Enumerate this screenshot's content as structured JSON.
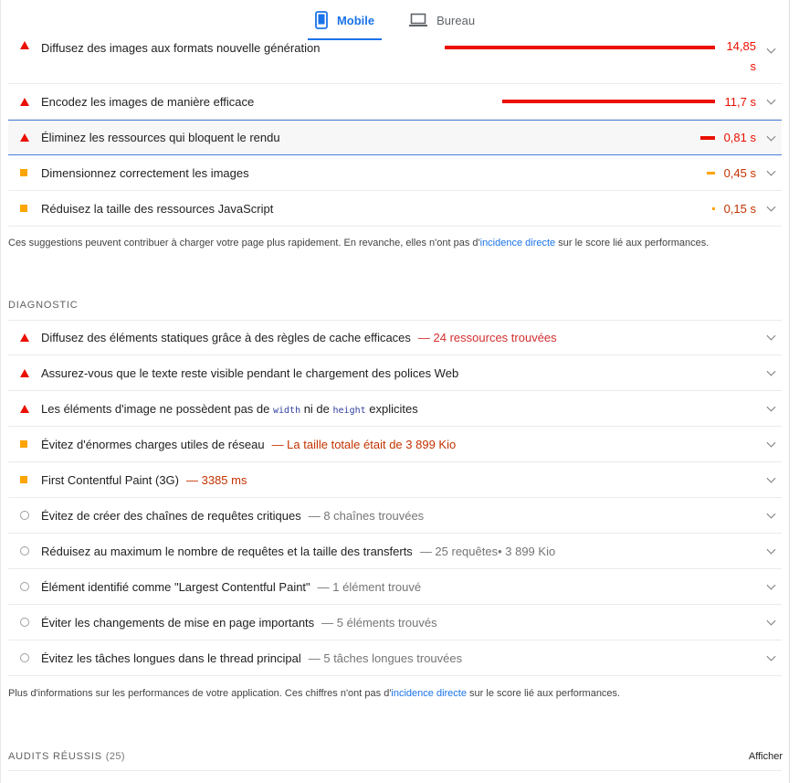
{
  "tabs": {
    "mobile_label": "Mobile",
    "desktop_label": "Bureau"
  },
  "opportunities": [
    {
      "title": "Diffusez des images aux formats nouvelle génération",
      "value_line1": "14,85",
      "value_line2": "s",
      "severity": "fail",
      "savings_fraction": 0.54
    },
    {
      "title": "Encodez les images de manière efficace",
      "value": "11,7 s",
      "severity": "fail",
      "savings_fraction": 0.43
    },
    {
      "title": "Éliminez les ressources qui bloquent le rendu",
      "value": "0,81 s",
      "severity": "fail",
      "savings_fraction": 0.03
    },
    {
      "title": "Dimensionnez correctement les images",
      "value": "0,45 s",
      "severity": "average",
      "savings_fraction": 0.02
    },
    {
      "title": "Réduisez la taille des ressources JavaScript",
      "value": "0,15 s",
      "severity": "average",
      "savings_fraction": 0.005
    }
  ],
  "opportunities_note": {
    "before": "Ces suggestions peuvent contribuer à charger votre page plus rapidement. En revanche, elles n'ont pas d'",
    "link": "incidence directe",
    "after": " sur le score lié aux performances."
  },
  "diagnostic": {
    "heading": "DIAGNOSTIC",
    "items": [
      {
        "title": "Diffusez des éléments statiques grâce à des règles de cache efficaces",
        "extra": "— 24 ressources trouvées",
        "severity": "fail"
      },
      {
        "title": "Assurez-vous que le texte reste visible pendant le chargement des polices Web",
        "severity": "fail"
      },
      {
        "title_a": "Les éléments d'image ne possèdent pas de ",
        "code_a": "width",
        "title_b": " ni de ",
        "code_b": "height",
        "title_c": " explicites",
        "severity": "fail"
      },
      {
        "title": "Évitez d'énormes charges utiles de réseau",
        "extra": "— La taille totale était de 3 899 Kio",
        "severity": "average"
      },
      {
        "title": "First Contentful Paint (3G)",
        "extra": "— 3385 ms",
        "severity": "average"
      },
      {
        "title": "Évitez de créer des chaînes de requêtes critiques",
        "extra": "— 8 chaînes trouvées",
        "severity": "info"
      },
      {
        "title": "Réduisez au maximum le nombre de requêtes et la taille des transferts",
        "extra": "— 25 requêtes• 3 899 Kio",
        "severity": "info"
      },
      {
        "title": "Élément identifié comme \"Largest Contentful Paint\"",
        "extra": "— 1 élément trouvé",
        "severity": "info"
      },
      {
        "title": "Éviter les changements de mise en page importants",
        "extra": "— 5 éléments trouvés",
        "severity": "info"
      },
      {
        "title": "Évitez les tâches longues dans le thread principal",
        "extra": "— 5 tâches longues trouvées",
        "severity": "info"
      }
    ]
  },
  "diagnostic_note": {
    "before": "Plus d'informations sur les performances de votre application. Ces chiffres n'ont pas d'",
    "link": "incidence directe",
    "after": " sur le score lié aux performances."
  },
  "passed": {
    "heading": "AUDITS RÉUSSIS",
    "count": "(25)",
    "show_label": "Afficher"
  },
  "colors": {
    "fail": "#eb0f00",
    "average": "#ffa400",
    "accent": "#1a73e8"
  }
}
